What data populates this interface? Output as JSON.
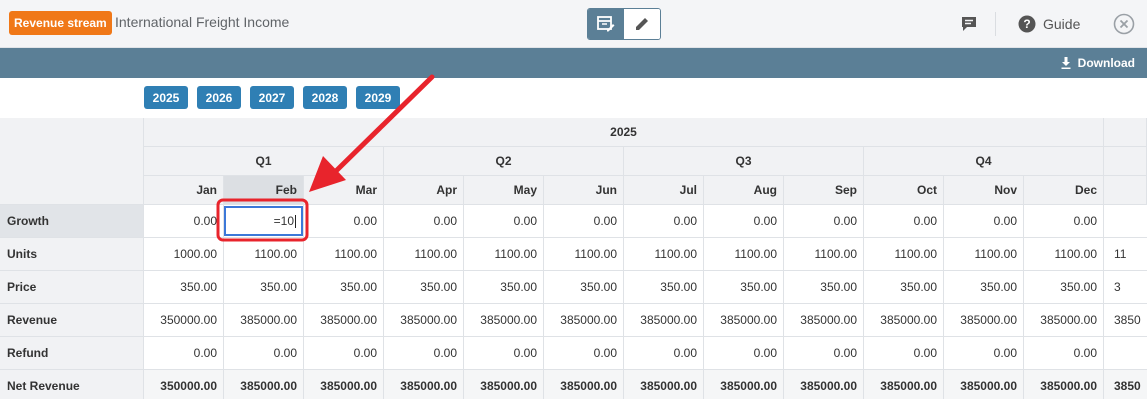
{
  "header": {
    "badge": "Revenue stream",
    "title": "International Freight Income",
    "guide_label": "Guide"
  },
  "toolbar": {
    "download_label": "Download"
  },
  "years": [
    "2025",
    "2026",
    "2027",
    "2028",
    "2029"
  ],
  "table": {
    "year": "2025",
    "quarters": [
      "Q1",
      "Q2",
      "Q3",
      "Q4"
    ],
    "months": [
      "Jan",
      "Feb",
      "Mar",
      "Apr",
      "May",
      "Jun",
      "Jul",
      "Aug",
      "Sep",
      "Oct",
      "Nov",
      "Dec"
    ],
    "selected_month": "Feb",
    "editing_cell_value": "=10",
    "rows": [
      {
        "label": "Growth",
        "values": [
          "0.00",
          "=10",
          "0.00",
          "0.00",
          "0.00",
          "0.00",
          "0.00",
          "0.00",
          "0.00",
          "0.00",
          "0.00",
          "0.00"
        ],
        "overflow": ""
      },
      {
        "label": "Units",
        "values": [
          "1000.00",
          "1100.00",
          "1100.00",
          "1100.00",
          "1100.00",
          "1100.00",
          "1100.00",
          "1100.00",
          "1100.00",
          "1100.00",
          "1100.00",
          "1100.00"
        ],
        "overflow": "11"
      },
      {
        "label": "Price",
        "values": [
          "350.00",
          "350.00",
          "350.00",
          "350.00",
          "350.00",
          "350.00",
          "350.00",
          "350.00",
          "350.00",
          "350.00",
          "350.00",
          "350.00"
        ],
        "overflow": "3"
      },
      {
        "label": "Revenue",
        "values": [
          "350000.00",
          "385000.00",
          "385000.00",
          "385000.00",
          "385000.00",
          "385000.00",
          "385000.00",
          "385000.00",
          "385000.00",
          "385000.00",
          "385000.00",
          "385000.00"
        ],
        "overflow": "3850"
      },
      {
        "label": "Refund",
        "values": [
          "0.00",
          "0.00",
          "0.00",
          "0.00",
          "0.00",
          "0.00",
          "0.00",
          "0.00",
          "0.00",
          "0.00",
          "0.00",
          "0.00"
        ],
        "overflow": ""
      },
      {
        "label": "Net Revenue",
        "values": [
          "350000.00",
          "385000.00",
          "385000.00",
          "385000.00",
          "385000.00",
          "385000.00",
          "385000.00",
          "385000.00",
          "385000.00",
          "385000.00",
          "385000.00",
          "385000.00"
        ],
        "overflow": "3850"
      }
    ]
  },
  "colors": {
    "badge": "#f07818",
    "toolbar": "#5b7f96",
    "year_button": "#2f7fb4",
    "annotation": "#e8242c",
    "editor_border": "#3c78d8"
  },
  "icons": [
    "table-edit-icon",
    "pencil-icon",
    "chat-icon",
    "help-circle-icon",
    "close-circle-icon",
    "download-icon",
    "annotation-arrow"
  ]
}
